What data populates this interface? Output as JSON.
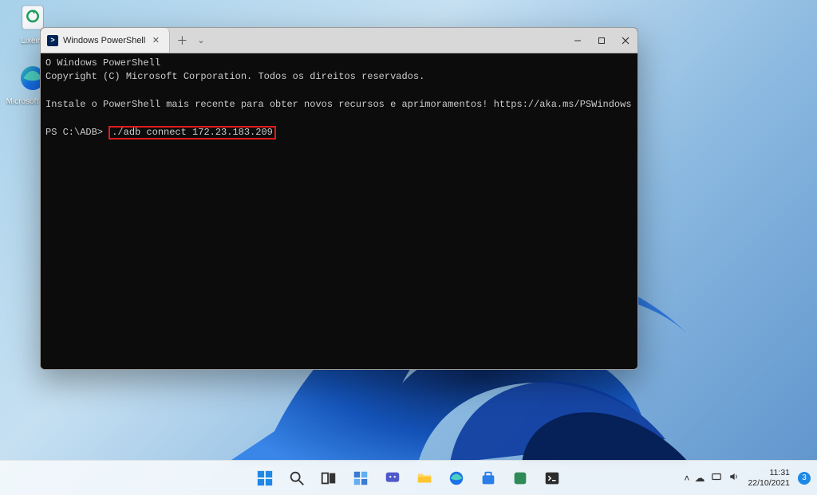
{
  "desktop": {
    "recycle_label": "Lixeira",
    "edge_label": "Microsoft Edge"
  },
  "window": {
    "tab_title": "Windows PowerShell"
  },
  "terminal": {
    "line1": "O Windows PowerShell",
    "line2": "Copyright (C) Microsoft Corporation. Todos os direitos reservados.",
    "line3": "Instale o PowerShell mais recente para obter novos recursos e aprimoramentos! https://aka.ms/PSWindows",
    "prompt": "PS C:\\ADB>",
    "command": "./adb connect 172.23.183.209"
  },
  "taskbar": {
    "time": "11:31",
    "date": "22/10/2021",
    "notif_count": "3"
  }
}
